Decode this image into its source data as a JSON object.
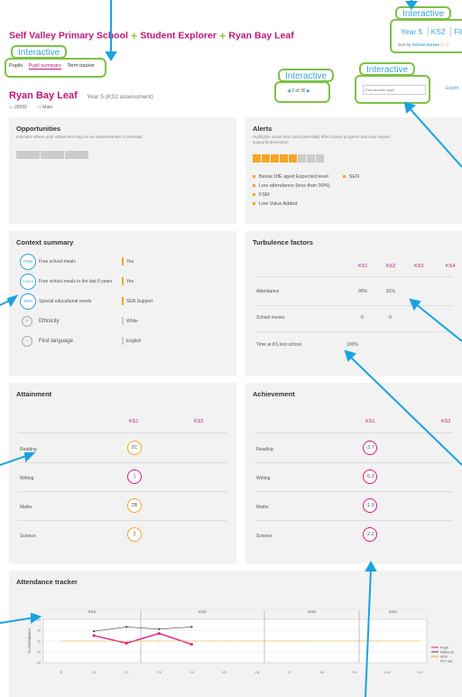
{
  "breadcrumb": {
    "school": "Self Valley Primary School",
    "explorer": "Student Explorer",
    "pupil": "Ryan Bay Leaf"
  },
  "callouts": {
    "label": "Interactive"
  },
  "year_selector": {
    "year": "Year 5",
    "ks": "KS2",
    "filter": "Fil",
    "sort_prefix": "Sort by",
    "sort_value": "School moves",
    "sort_suffix": "(+ 2)"
  },
  "tabs": [
    "Pupils",
    "Pupil summary",
    "Term tracker"
  ],
  "pager": {
    "text": "2 of 30"
  },
  "find_pupil": {
    "placeholder": "Find another pupil"
  },
  "export": "Export",
  "pupil": {
    "name": "Ryan Bay Leaf",
    "year": "Year 5 (KS2 assessment)",
    "dob": "28/05/",
    "gender": "Male"
  },
  "opportunities": {
    "title": "Opportunities",
    "subtitle": "Indicates where prior attainment may be an underestimate of potential"
  },
  "alerts": {
    "title": "Alerts",
    "subtitle": "Highlights areas that could potentially affect future progress and may require support/intervention",
    "items": [
      "Below DfE aged Expected level",
      "Low attendance (less than 90%)",
      "FSM",
      "Low Value Added"
    ],
    "extra": "SEN",
    "color": "#f5a623"
  },
  "context": {
    "title": "Context summary",
    "rows": [
      {
        "badge": "FSM",
        "label": "Free school meals",
        "value": "Yes"
      },
      {
        "badge": "FSM 6",
        "label": "Free school meals in the last 6 years",
        "value": "Yes"
      },
      {
        "badge": "SEN",
        "label": "Special educational needs",
        "value": "SEN Support"
      },
      {
        "badge": "",
        "label": "Ethnicity",
        "value": "White"
      },
      {
        "badge": "",
        "label": "First language",
        "value": "English"
      }
    ]
  },
  "turbulence": {
    "title": "Turbulence factors",
    "headers": [
      "KS1",
      "KS2",
      "KS3",
      "KS4"
    ],
    "rows": [
      {
        "label": "Attendance",
        "v1": "90%",
        "v2": "91%"
      },
      {
        "label": "School moves",
        "v1": "0",
        "v2": "0"
      },
      {
        "label": "Time at KS test school",
        "v1": "100%",
        "v2": ""
      }
    ]
  },
  "attainment": {
    "title": "Attainment",
    "headers": [
      "KS1",
      "KS2"
    ],
    "rows": [
      {
        "label": "Reading",
        "value": "2C"
      },
      {
        "label": "Writing",
        "value": "1"
      },
      {
        "label": "Maths",
        "value": "2B"
      },
      {
        "label": "Science",
        "value": "2"
      }
    ]
  },
  "achievement": {
    "title": "Achievement",
    "headers": [
      "KS1",
      "KS2"
    ],
    "rows": [
      {
        "label": "Reading",
        "value": "-3.7"
      },
      {
        "label": "Writing",
        "value": "-5.3"
      },
      {
        "label": "Maths",
        "value": "-1.9"
      },
      {
        "label": "Science",
        "value": "-2.2"
      }
    ]
  },
  "chart_data": {
    "type": "line",
    "title": "Attendance tracker",
    "ylabel": "% Attendance",
    "ks_labels": [
      "KS1",
      "KS2",
      "KS3",
      "KS4"
    ],
    "categories": [
      "R",
      "Y1",
      "Y2",
      "Y3",
      "Y4",
      "Y5",
      "Y6",
      "Y7",
      "Y8",
      "Y9",
      "Y10",
      "Y11"
    ],
    "ylim": [
      80,
      100
    ],
    "yticks": [
      "100",
      "95",
      "90",
      "85",
      "80"
    ],
    "series": [
      {
        "name": "Pupil",
        "color": "#e0157f",
        "values": [
          null,
          92.5,
          89,
          93.5,
          88.5
        ]
      },
      {
        "name": "National",
        "color": "#444444",
        "values": [
          null,
          94.5,
          96.5,
          95.5,
          96.5
        ]
      },
      {
        "name": "90%",
        "color": "#f5a623",
        "values": [
          90,
          90,
          90,
          90,
          90,
          90,
          90,
          90,
          90,
          90,
          90,
          90
        ]
      }
    ],
    "legend_extra": "FFT ale"
  }
}
